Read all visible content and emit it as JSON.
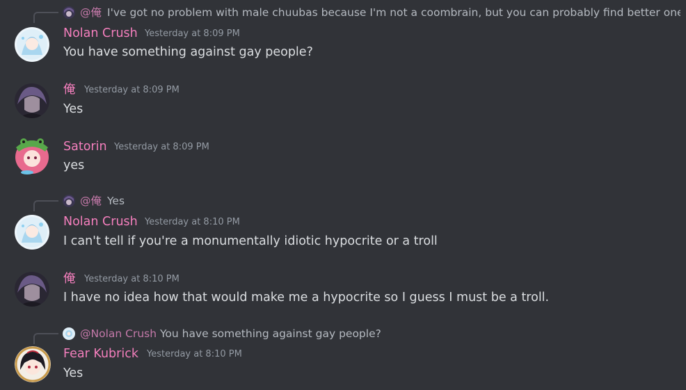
{
  "channel": {
    "messages": [
      {
        "reply": {
          "name": "@俺",
          "text": "I've got no problem with male chuubas because I'm not a coombrain, but you can probably find better one"
        },
        "author": "Nolan Crush",
        "timestamp": "Yesterday at 8:09 PM",
        "content": "You have something against gay people?",
        "avatar_icon": "nolan-crush-avatar"
      },
      {
        "author": "俺",
        "timestamp": "Yesterday at 8:09 PM",
        "content": "Yes",
        "avatar_icon": "ore-avatar"
      },
      {
        "author": "Satorin",
        "timestamp": "Yesterday at 8:09 PM",
        "content": "yes",
        "avatar_icon": "satorin-avatar"
      },
      {
        "reply": {
          "name": "@俺",
          "text": "Yes"
        },
        "author": "Nolan Crush",
        "timestamp": "Yesterday at 8:10 PM",
        "content": "I can't tell if you're a monumentally idiotic hypocrite or a troll",
        "avatar_icon": "nolan-crush-avatar"
      },
      {
        "author": "俺",
        "timestamp": "Yesterday at 8:10 PM",
        "content": "I have no idea how that would make me a hypocrite so I guess I must be a troll.",
        "avatar_icon": "ore-avatar"
      },
      {
        "reply": {
          "name": "@Nolan Crush",
          "text": "You have something against gay people?"
        },
        "author": "Fear Kubrick",
        "timestamp": "Yesterday at 8:10 PM",
        "content": "Yes",
        "avatar_icon": "fear-kubrick-avatar"
      }
    ]
  },
  "colors": {
    "background": "#313338",
    "author_name": "#f47fbd",
    "reply_name": "#c479a9",
    "timestamp": "#949ba4",
    "text": "#dbdee1"
  }
}
